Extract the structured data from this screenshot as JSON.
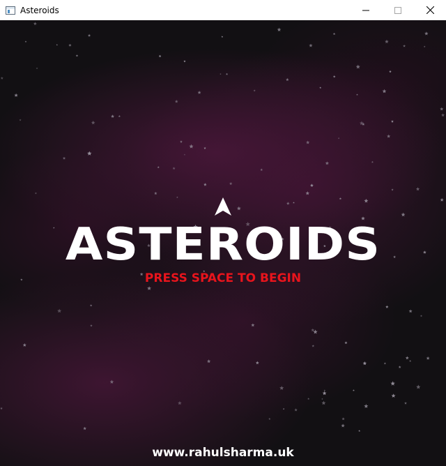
{
  "window": {
    "title": "Asteroids",
    "icon": "app-window-icon",
    "controls": [
      "minimize-icon",
      "maximize-icon",
      "close-icon"
    ]
  },
  "game": {
    "title": "ASTEROIDS",
    "prompt": "PRESS SPACE TO BEGIN",
    "website": "www.rahulsharma.uk",
    "player_icon": "ship-icon"
  },
  "colors": {
    "background": "#121013",
    "nebula": "#46163a",
    "title": "#ffffff",
    "prompt": "#e8141c",
    "star": "#9a94a0"
  }
}
